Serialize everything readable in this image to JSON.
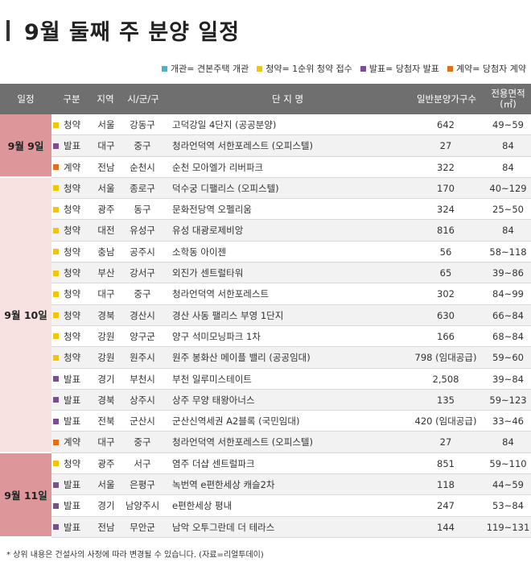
{
  "title": "9월 둘째 주 분양 일정",
  "legend": [
    {
      "label": "개관= 견본주택 개관",
      "color": "#4bb4c0"
    },
    {
      "label": "청약= 1순위 청약 접수",
      "color": "#f1c40f"
    },
    {
      "label": "발표= 당첨자 발표",
      "color": "#7b4f8f"
    },
    {
      "label": "계약= 당첨자 계약",
      "color": "#e1701e"
    }
  ],
  "headers": {
    "date": "일정",
    "type": "구분",
    "region": "지역",
    "city": "시/군/구",
    "name": "단 지 명",
    "units": "일반분양가구수",
    "area": "전용면적(㎡)"
  },
  "type_colors": {
    "청약": "#f1c40f",
    "발표": "#7b4f8f",
    "계약": "#e1701e"
  },
  "date_groups": [
    {
      "label": "9월 9일",
      "rows": 3
    },
    {
      "label": "9월 10일",
      "rows": 13
    },
    {
      "label": "9월 11일",
      "rows": 4
    }
  ],
  "rows": [
    {
      "type": "청약",
      "region": "서울",
      "city": "강동구",
      "name": "고덕강일 4단지 (공공분양)",
      "units": "642",
      "area": "49~59"
    },
    {
      "type": "발표",
      "region": "대구",
      "city": "중구",
      "name": "청라언덕역 서한포레스트 (오피스텔)",
      "units": "27",
      "area": "84"
    },
    {
      "type": "계약",
      "region": "전남",
      "city": "순천시",
      "name": "순천 모아엘가 리버파크",
      "units": "322",
      "area": "84"
    },
    {
      "type": "청약",
      "region": "서울",
      "city": "종로구",
      "name": "덕수궁 디팰리스 (오피스텔)",
      "units": "170",
      "area": "40~129"
    },
    {
      "type": "청약",
      "region": "광주",
      "city": "동구",
      "name": "문화전당역 오펠리움",
      "units": "324",
      "area": "25~50"
    },
    {
      "type": "청약",
      "region": "대전",
      "city": "유성구",
      "name": "유성 대광로제비앙",
      "units": "816",
      "area": "84"
    },
    {
      "type": "청약",
      "region": "충남",
      "city": "공주시",
      "name": "소학동 아이젠",
      "units": "56",
      "area": "58~118"
    },
    {
      "type": "청약",
      "region": "부산",
      "city": "강서구",
      "name": "외진가 센트럴타워",
      "units": "65",
      "area": "39~86"
    },
    {
      "type": "청약",
      "region": "대구",
      "city": "중구",
      "name": "청라언덕역 서한포레스트",
      "units": "302",
      "area": "84~99"
    },
    {
      "type": "청약",
      "region": "경북",
      "city": "경산시",
      "name": "경산 사동 팰리스 부영 1단지",
      "units": "630",
      "area": "66~84"
    },
    {
      "type": "청약",
      "region": "강원",
      "city": "양구군",
      "name": "양구 석미모닝파크 1차",
      "units": "166",
      "area": "68~84"
    },
    {
      "type": "청약",
      "region": "강원",
      "city": "원주시",
      "name": "원주 봉화산 메이플 밸리 (공공임대)",
      "units": "798 (임대공급)",
      "area": "59~60"
    },
    {
      "type": "발표",
      "region": "경기",
      "city": "부천시",
      "name": "부천 일루미스테이트",
      "units": "2,508",
      "area": "39~84"
    },
    {
      "type": "발표",
      "region": "경북",
      "city": "상주시",
      "name": "상주 무양 태왕아너스",
      "units": "135",
      "area": "59~123"
    },
    {
      "type": "발표",
      "region": "전북",
      "city": "군산시",
      "name": "군산신역세권 A2블록 (국민임대)",
      "units": "420 (임대공급)",
      "area": "33~46"
    },
    {
      "type": "계약",
      "region": "대구",
      "city": "중구",
      "name": "청라언덕역 서한포레스트 (오피스텔)",
      "units": "27",
      "area": "84"
    },
    {
      "type": "청약",
      "region": "광주",
      "city": "서구",
      "name": "염주 더샵 센트럴파크",
      "units": "851",
      "area": "59~110"
    },
    {
      "type": "발표",
      "region": "서울",
      "city": "은평구",
      "name": "녹번역 e편한세상 캐슬2차",
      "units": "118",
      "area": "44~59"
    },
    {
      "type": "발표",
      "region": "경기",
      "city": "남양주시",
      "name": "e편한세상 평내",
      "units": "247",
      "area": "53~84"
    },
    {
      "type": "발표",
      "region": "전남",
      "city": "무안군",
      "name": "남악 오투그란데 더 테라스",
      "units": "144",
      "area": "119~131"
    }
  ],
  "footnote": "* 상위 내용은 건설사의 사정에 따라 변경될 수 있습니다. (자료=리얼투데이)"
}
